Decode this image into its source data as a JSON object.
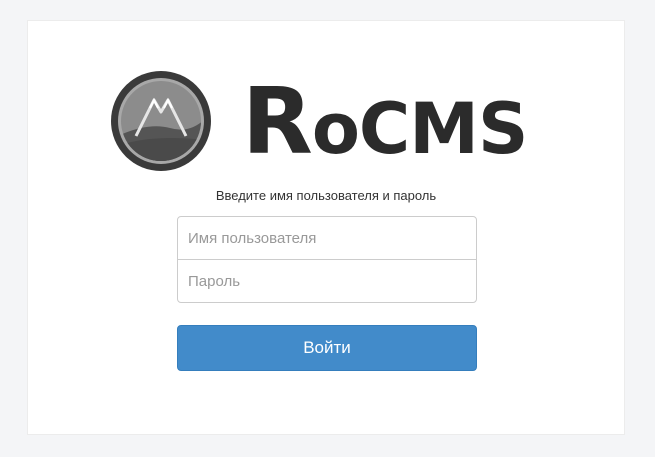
{
  "brand": {
    "name_initial": "R",
    "name_rest": "oCMS",
    "logo_icon": "mountain-circle-icon"
  },
  "login": {
    "prompt": "Введите имя пользователя и пароль",
    "username_placeholder": "Имя пользователя",
    "username_value": "",
    "password_placeholder": "Пароль",
    "password_value": "",
    "submit_label": "Войти"
  },
  "colors": {
    "page_background": "#f4f5f7",
    "card_background": "#ffffff",
    "logo_text": "#2b2b2b",
    "button": "#428bca"
  }
}
